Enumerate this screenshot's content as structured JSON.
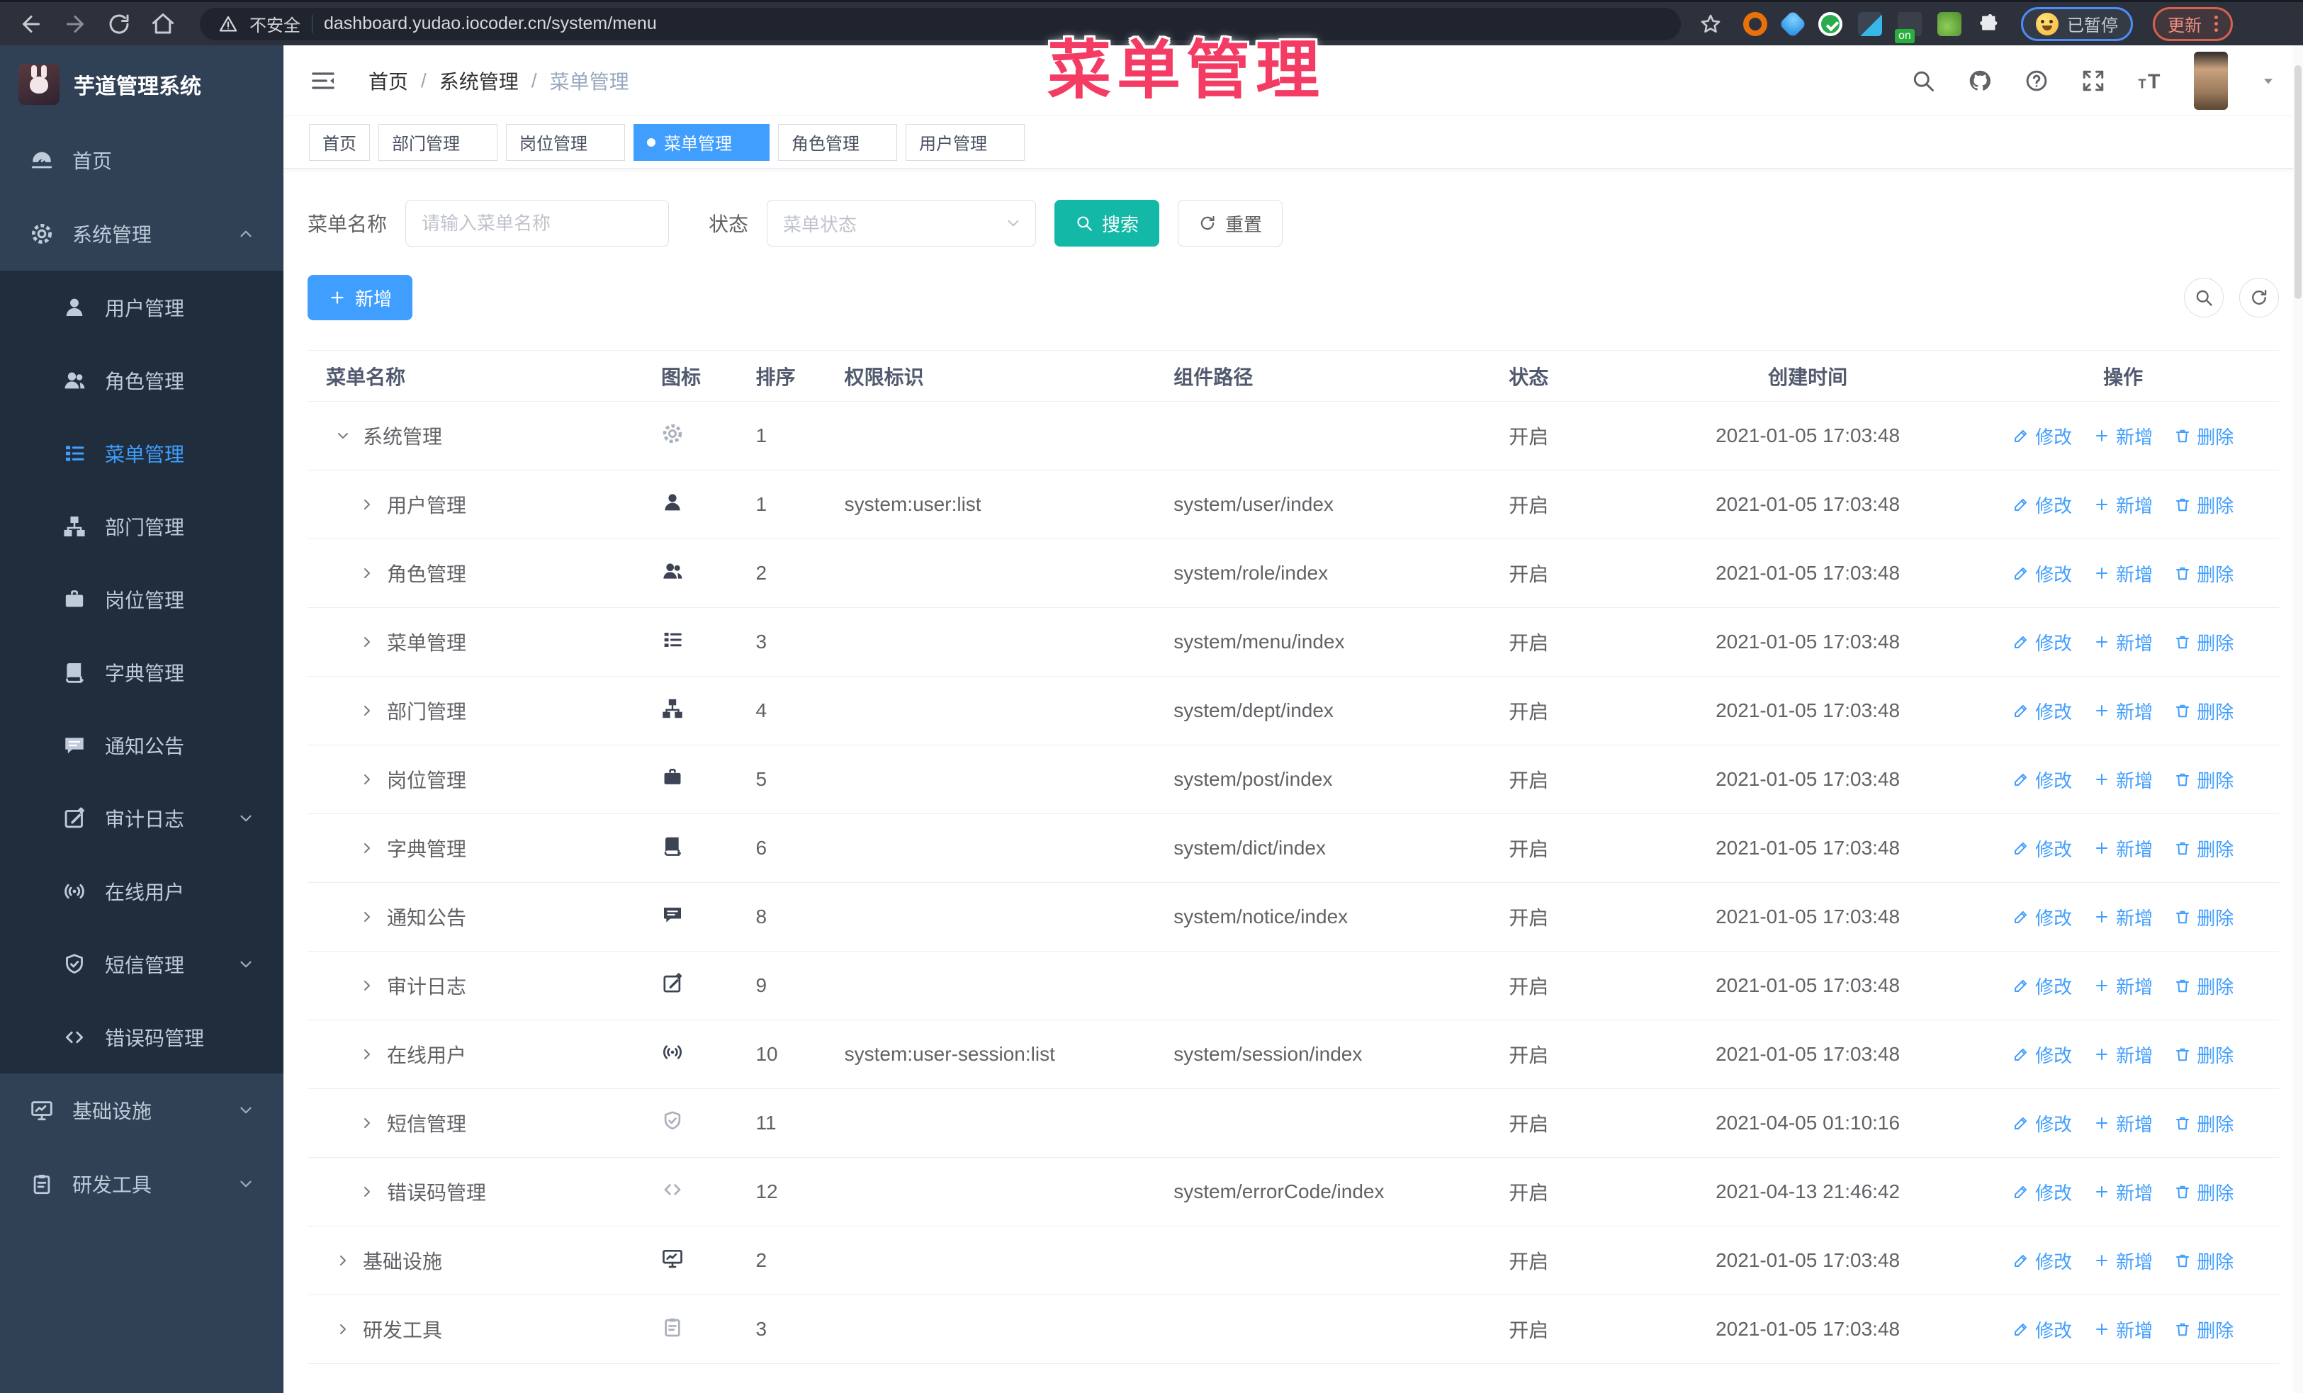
{
  "browser": {
    "security_label": "不安全",
    "url": "dashboard.yudao.iocoder.cn/system/menu",
    "profile_status": "已暂停",
    "update_label": "更新",
    "on_badge": "on"
  },
  "annotation": {
    "text": "菜单管理"
  },
  "app": {
    "title": "芋道管理系统"
  },
  "breadcrumb": [
    "首页",
    "系统管理",
    "菜单管理"
  ],
  "sidebar": {
    "items": [
      {
        "label": "首页",
        "icon": "dashboard-icon",
        "type": "top",
        "active": false,
        "chevron": ""
      },
      {
        "label": "系统管理",
        "icon": "gear-icon",
        "type": "top",
        "active": false,
        "chevron": "up"
      },
      {
        "label": "用户管理",
        "icon": "user-icon",
        "type": "sub",
        "active": false,
        "chevron": ""
      },
      {
        "label": "角色管理",
        "icon": "users-icon",
        "type": "sub",
        "active": false,
        "chevron": ""
      },
      {
        "label": "菜单管理",
        "icon": "menu-tree-icon",
        "type": "sub",
        "active": true,
        "chevron": ""
      },
      {
        "label": "部门管理",
        "icon": "org-tree-icon",
        "type": "sub",
        "active": false,
        "chevron": ""
      },
      {
        "label": "岗位管理",
        "icon": "badge-icon",
        "type": "sub",
        "active": false,
        "chevron": ""
      },
      {
        "label": "字典管理",
        "icon": "book-icon",
        "type": "sub",
        "active": false,
        "chevron": ""
      },
      {
        "label": "通知公告",
        "icon": "megaphone-icon",
        "type": "sub",
        "active": false,
        "chevron": ""
      },
      {
        "label": "审计日志",
        "icon": "edit-icon",
        "type": "sub",
        "active": false,
        "chevron": "down"
      },
      {
        "label": "在线用户",
        "icon": "online-icon",
        "type": "sub",
        "active": false,
        "chevron": ""
      },
      {
        "label": "短信管理",
        "icon": "shield-icon",
        "type": "sub",
        "active": false,
        "chevron": "down"
      },
      {
        "label": "错误码管理",
        "icon": "code-icon",
        "type": "sub",
        "active": false,
        "chevron": ""
      },
      {
        "label": "基础设施",
        "icon": "monitor-icon",
        "type": "top",
        "active": false,
        "chevron": "down"
      },
      {
        "label": "研发工具",
        "icon": "tool-icon",
        "type": "top",
        "active": false,
        "chevron": "down"
      }
    ]
  },
  "tags": [
    {
      "label": "首页",
      "closable": false,
      "active": false
    },
    {
      "label": "部门管理",
      "closable": true,
      "active": false
    },
    {
      "label": "岗位管理",
      "closable": true,
      "active": false
    },
    {
      "label": "菜单管理",
      "closable": true,
      "active": true
    },
    {
      "label": "角色管理",
      "closable": true,
      "active": false
    },
    {
      "label": "用户管理",
      "closable": true,
      "active": false
    }
  ],
  "filters": {
    "name_label": "菜单名称",
    "name_placeholder": "请输入菜单名称",
    "name_value": "",
    "status_label": "状态",
    "status_placeholder": "菜单状态",
    "search_label": "搜索",
    "reset_label": "重置"
  },
  "toolbar": {
    "add_label": "新增"
  },
  "table": {
    "columns": [
      "菜单名称",
      "图标",
      "排序",
      "权限标识",
      "组件路径",
      "状态",
      "创建时间",
      "操作"
    ],
    "row_actions": [
      {
        "label": "修改",
        "icon": "edit-pen-icon"
      },
      {
        "label": "新增",
        "icon": "plus-icon"
      },
      {
        "label": "删除",
        "icon": "trash-icon"
      }
    ],
    "rows": [
      {
        "name": "系统管理",
        "icon": "gear-icon",
        "muted": true,
        "level": 0,
        "expanded": true,
        "order": "1",
        "perm": "",
        "path": "",
        "status": "开启",
        "time": "2021-01-05 17:03:48"
      },
      {
        "name": "用户管理",
        "icon": "user-icon",
        "muted": false,
        "level": 1,
        "expanded": false,
        "order": "1",
        "perm": "system:user:list",
        "path": "system/user/index",
        "status": "开启",
        "time": "2021-01-05 17:03:48"
      },
      {
        "name": "角色管理",
        "icon": "users-icon",
        "muted": false,
        "level": 1,
        "expanded": false,
        "order": "2",
        "perm": "",
        "path": "system/role/index",
        "status": "开启",
        "time": "2021-01-05 17:03:48"
      },
      {
        "name": "菜单管理",
        "icon": "menu-tree-icon",
        "muted": false,
        "level": 1,
        "expanded": false,
        "order": "3",
        "perm": "",
        "path": "system/menu/index",
        "status": "开启",
        "time": "2021-01-05 17:03:48"
      },
      {
        "name": "部门管理",
        "icon": "org-tree-icon",
        "muted": false,
        "level": 1,
        "expanded": false,
        "order": "4",
        "perm": "",
        "path": "system/dept/index",
        "status": "开启",
        "time": "2021-01-05 17:03:48"
      },
      {
        "name": "岗位管理",
        "icon": "badge-icon",
        "muted": false,
        "level": 1,
        "expanded": false,
        "order": "5",
        "perm": "",
        "path": "system/post/index",
        "status": "开启",
        "time": "2021-01-05 17:03:48"
      },
      {
        "name": "字典管理",
        "icon": "book-icon",
        "muted": false,
        "level": 1,
        "expanded": false,
        "order": "6",
        "perm": "",
        "path": "system/dict/index",
        "status": "开启",
        "time": "2021-01-05 17:03:48"
      },
      {
        "name": "通知公告",
        "icon": "megaphone-icon",
        "muted": false,
        "level": 1,
        "expanded": false,
        "order": "8",
        "perm": "",
        "path": "system/notice/index",
        "status": "开启",
        "time": "2021-01-05 17:03:48"
      },
      {
        "name": "审计日志",
        "icon": "edit-icon",
        "muted": false,
        "level": 1,
        "expanded": false,
        "order": "9",
        "perm": "",
        "path": "",
        "status": "开启",
        "time": "2021-01-05 17:03:48"
      },
      {
        "name": "在线用户",
        "icon": "online-icon",
        "muted": false,
        "level": 1,
        "expanded": false,
        "order": "10",
        "perm": "system:user-session:list",
        "path": "system/session/index",
        "status": "开启",
        "time": "2021-01-05 17:03:48"
      },
      {
        "name": "短信管理",
        "icon": "shield-icon",
        "muted": true,
        "level": 1,
        "expanded": false,
        "order": "11",
        "perm": "",
        "path": "",
        "status": "开启",
        "time": "2021-04-05 01:10:16"
      },
      {
        "name": "错误码管理",
        "icon": "code-icon",
        "muted": true,
        "level": 1,
        "expanded": false,
        "order": "12",
        "perm": "",
        "path": "system/errorCode/index",
        "status": "开启",
        "time": "2021-04-13 21:46:42"
      },
      {
        "name": "基础设施",
        "icon": "monitor-icon",
        "muted": false,
        "level": 0,
        "expanded": false,
        "order": "2",
        "perm": "",
        "path": "",
        "status": "开启",
        "time": "2021-01-05 17:03:48"
      },
      {
        "name": "研发工具",
        "icon": "tool-icon",
        "muted": true,
        "level": 0,
        "expanded": false,
        "order": "3",
        "perm": "",
        "path": "",
        "status": "开启",
        "time": "2021-01-05 17:03:48"
      }
    ]
  }
}
